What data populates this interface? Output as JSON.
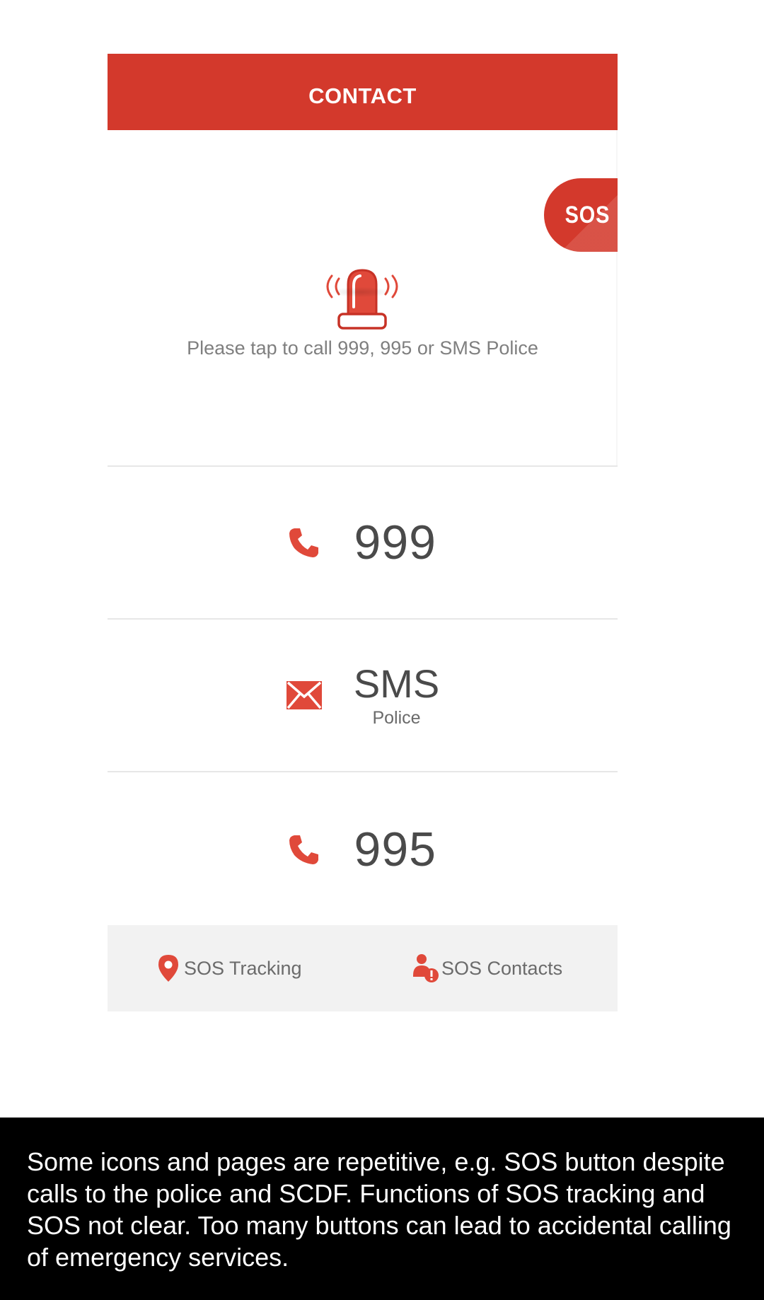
{
  "header": {
    "title": "CONTACT"
  },
  "hero": {
    "siren_icon": "siren-icon",
    "sos_badge_label": "SOS",
    "hint": "Please tap to call 999, 995 or SMS Police"
  },
  "options": [
    {
      "icon": "phone-icon",
      "label": "999"
    },
    {
      "icon": "envelope-icon",
      "label": "SMS",
      "sublabel": "Police"
    },
    {
      "icon": "phone-icon",
      "label": "995"
    }
  ],
  "bottom_bar": {
    "tracking": {
      "icon": "location-pin-icon",
      "label": "SOS Tracking"
    },
    "contacts": {
      "icon": "person-alert-icon",
      "label": "SOS Contacts"
    }
  },
  "caption": {
    "text": "Some icons and pages are repetitive, e.g. SOS button despite calls to the police and SCDF. Functions of SOS tracking and SOS not clear. Too many buttons can lead to accidental calling of emergency services."
  },
  "colors": {
    "accent": "#d3392c",
    "icon_red": "#e0493a",
    "text_gray": "#4a4a4a",
    "bar_bg": "#f2f2f2",
    "caption_bg": "#000000"
  }
}
